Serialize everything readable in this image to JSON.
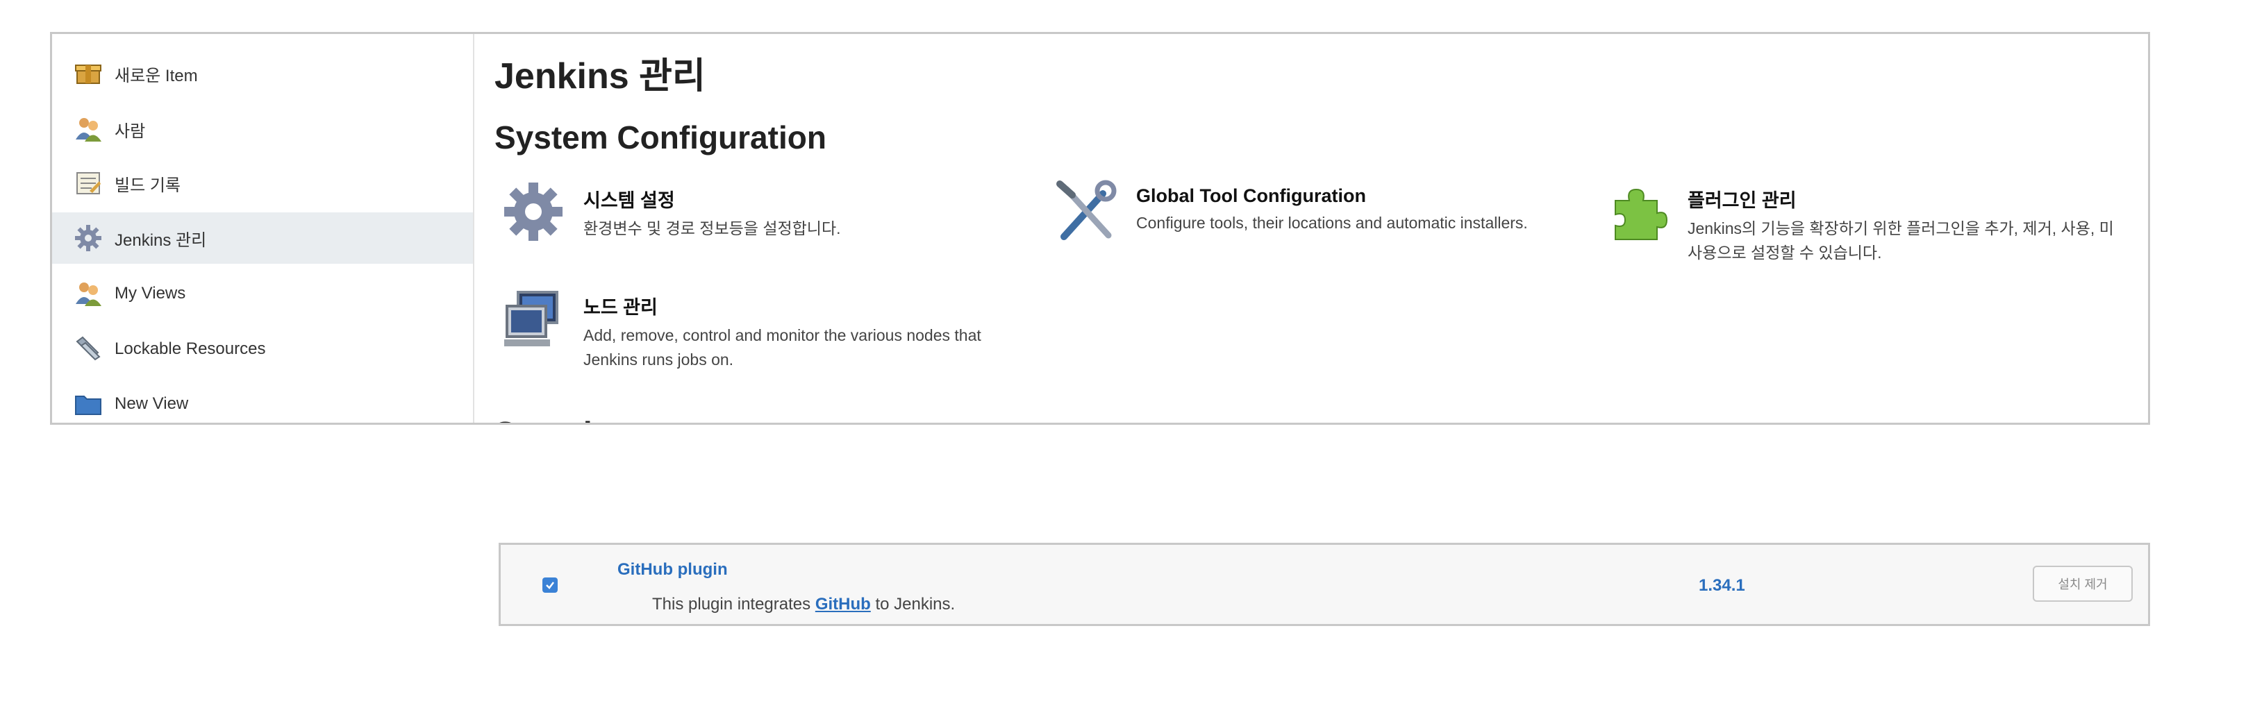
{
  "sidebar": {
    "items": [
      {
        "label": "새로운 Item",
        "icon": "new-item-icon"
      },
      {
        "label": "사람",
        "icon": "people-icon"
      },
      {
        "label": "빌드 기록",
        "icon": "build-history-icon"
      },
      {
        "label": "Jenkins 관리",
        "icon": "gear-icon",
        "active": true
      },
      {
        "label": "My Views",
        "icon": "people-icon"
      },
      {
        "label": "Lockable Resources",
        "icon": "lock-resources-icon"
      },
      {
        "label": "New View",
        "icon": "folder-icon"
      }
    ]
  },
  "main": {
    "title": "Jenkins 관리",
    "section_title": "System Configuration",
    "next_section_title": "Security",
    "items": [
      {
        "title": "시스템 설정",
        "desc": "환경변수 및 경로 정보등을 설정합니다.",
        "icon": "gear-icon"
      },
      {
        "title": "Global Tool Configuration",
        "desc": "Configure tools, their locations and automatic installers.",
        "icon": "tools-icon"
      },
      {
        "title": "플러그인 관리",
        "desc_line1": "Jenkins의 기능을 확장하기 위한 플러그인을 추가, 제거, 사용, 미",
        "desc_line2": "사용으로 설정할 수 있습니다.",
        "icon": "puzzle-icon"
      },
      {
        "title": "노드 관리",
        "desc_line1": "Add, remove, control and monitor the various nodes that",
        "desc_line2": "Jenkins runs jobs on.",
        "icon": "computer-icon"
      }
    ]
  },
  "plugin": {
    "name": "GitHub plugin",
    "desc_before": "This plugin integrates",
    "desc_link": "GitHub",
    "desc_after": "to Jenkins.",
    "version": "1.34.1",
    "uninstall_label": "설치 제거",
    "checked": true
  },
  "colors": {
    "link": "#2a6ebd",
    "active_bg": "#e9edf0",
    "border": "#c8c8c8"
  }
}
